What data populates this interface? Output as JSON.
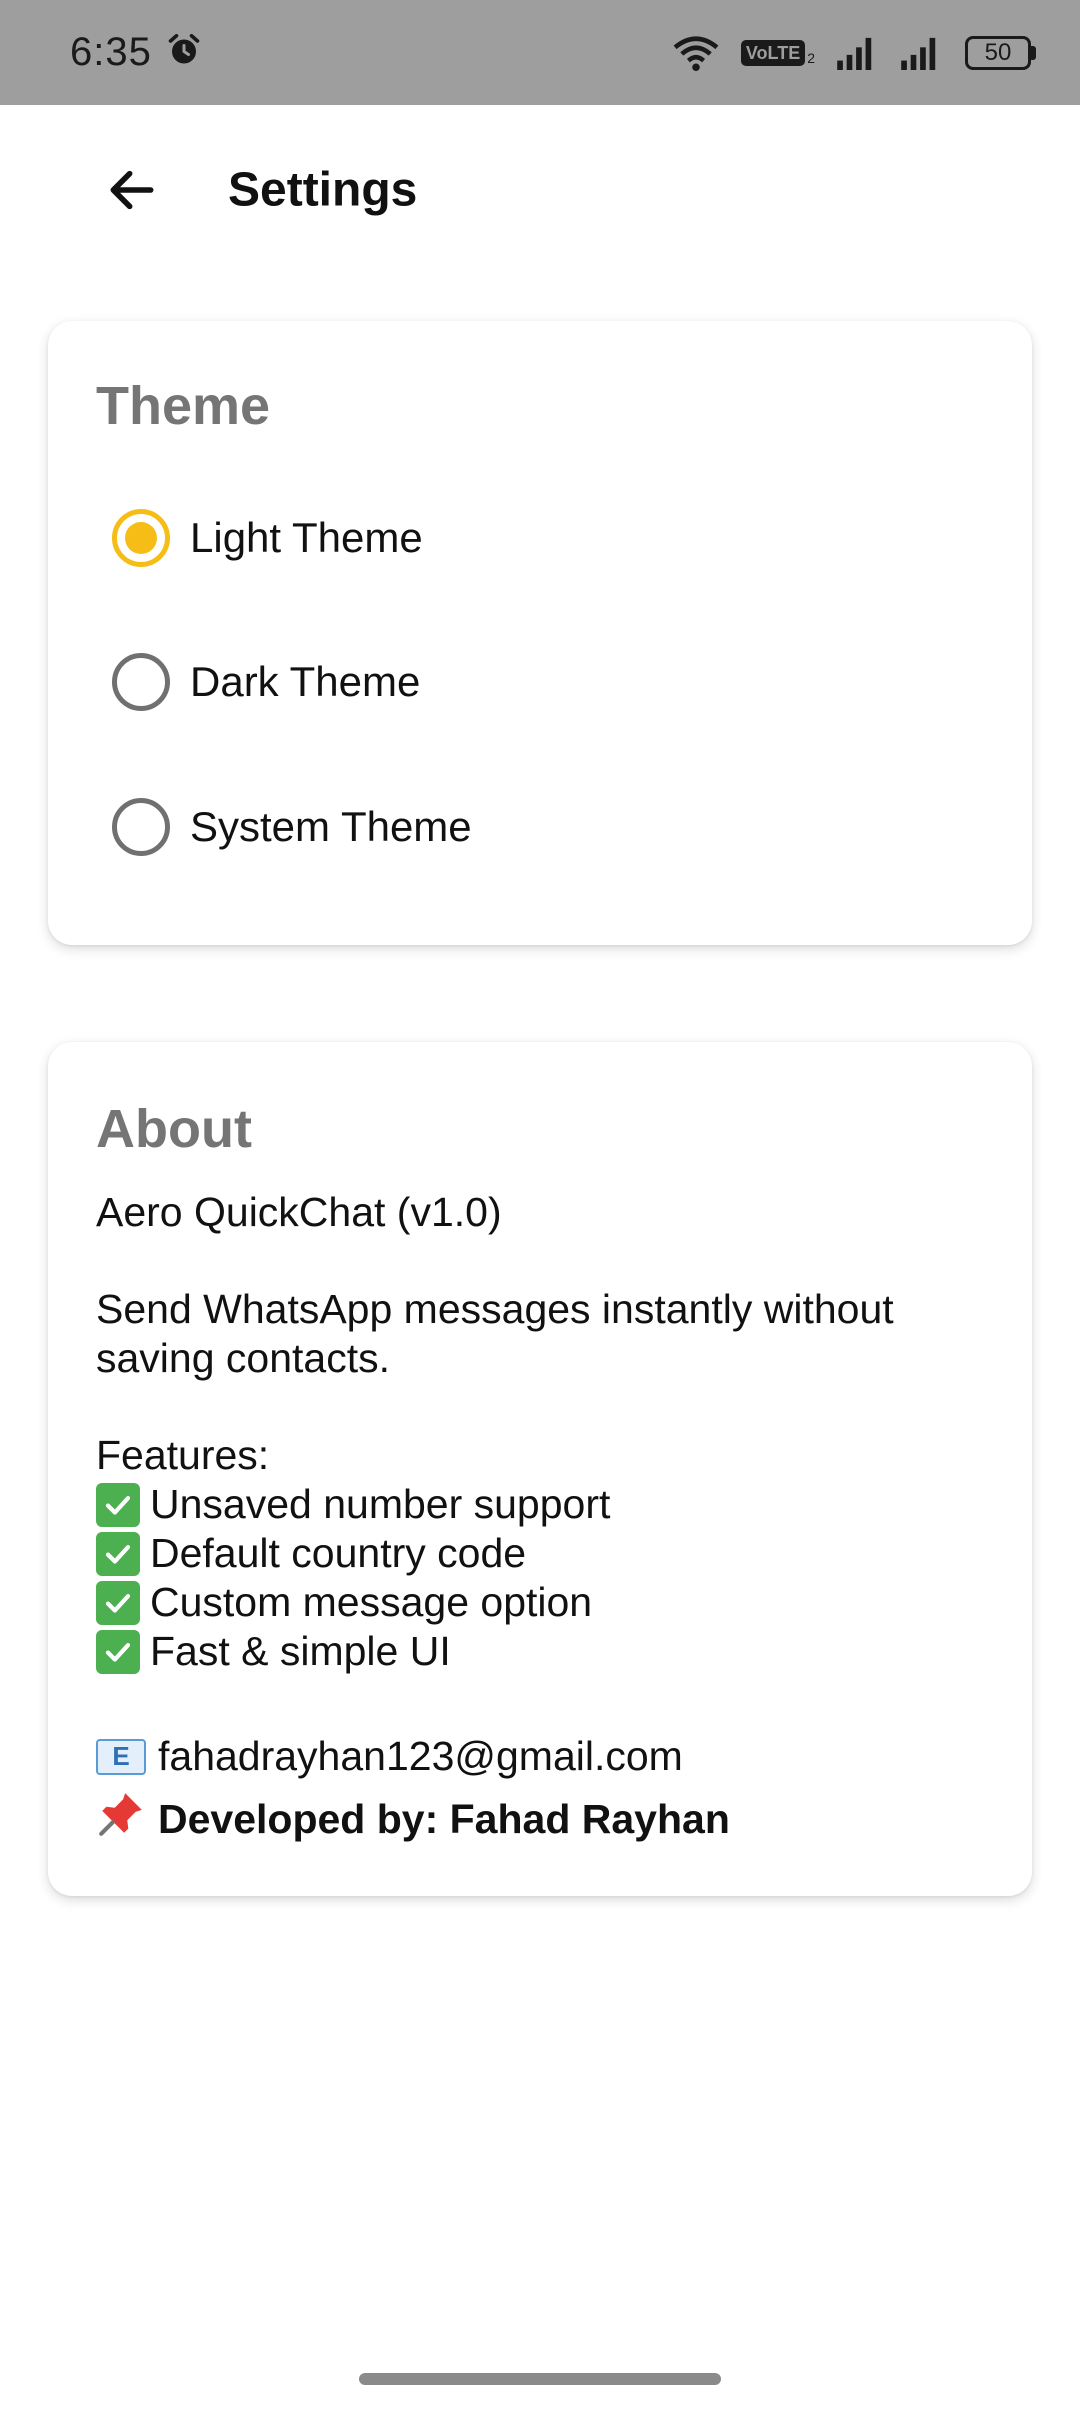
{
  "status_bar": {
    "time": "6:35",
    "alarm_icon": "alarm-clock-icon",
    "wifi_icon": "wifi-icon",
    "volte_label": "VoLTE",
    "volte_sub": "2",
    "signal_icons": [
      "signal-bars-icon",
      "signal-bars-icon"
    ],
    "battery_level": "50"
  },
  "app_bar": {
    "back_icon": "arrow-left-icon",
    "title": "Settings"
  },
  "theme_card": {
    "title": "Theme",
    "options": [
      {
        "label": "Light Theme",
        "checked": true
      },
      {
        "label": "Dark Theme",
        "checked": false
      },
      {
        "label": "System Theme",
        "checked": false
      }
    ],
    "accent_color": "#f5bd16"
  },
  "about_card": {
    "title": "About",
    "app_name_version": "Aero QuickChat (v1.0)",
    "description": "Send WhatsApp messages instantly without saving contacts.",
    "features_heading": "Features:",
    "features": [
      "Unsaved number support",
      "Default country code",
      "Custom message option",
      "Fast & simple UI"
    ],
    "email": "fahadrayhan123@gmail.com",
    "developer": "Developed by: Fahad Rayhan"
  }
}
